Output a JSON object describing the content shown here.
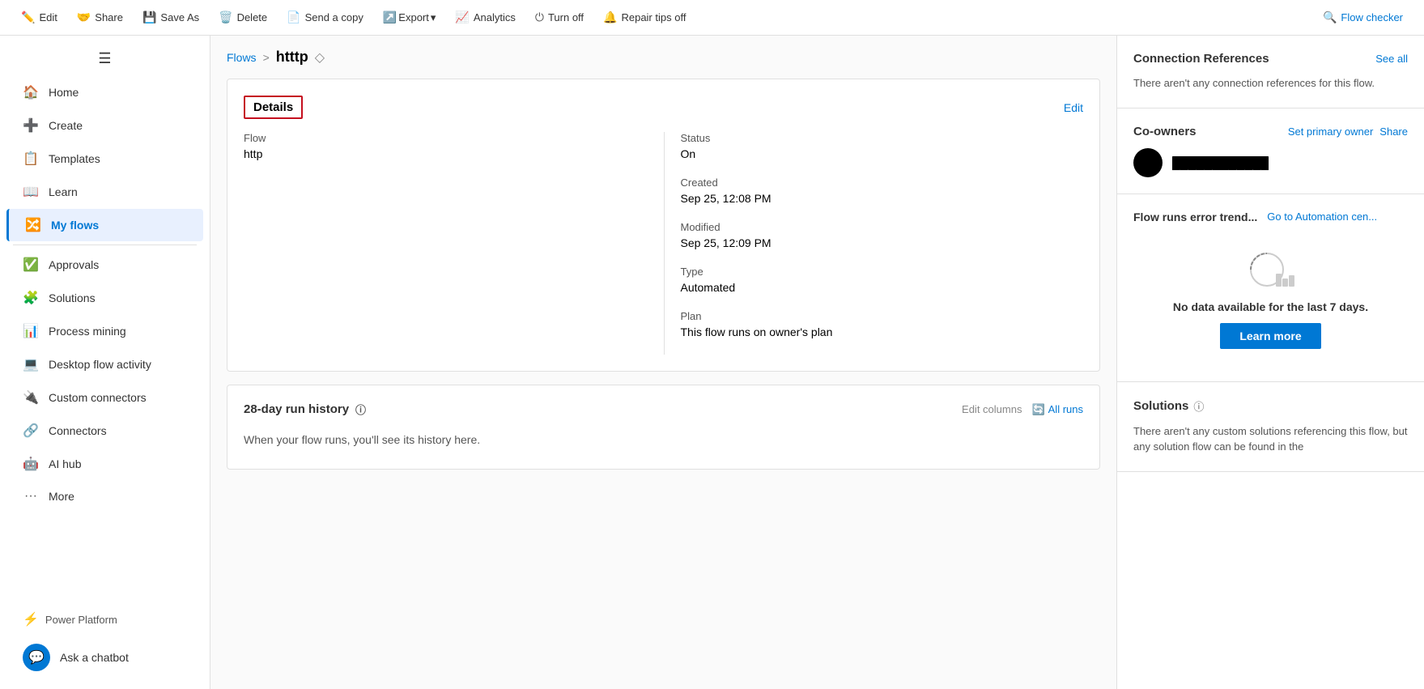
{
  "toolbar": {
    "edit_label": "Edit",
    "share_label": "Share",
    "save_as_label": "Save As",
    "delete_label": "Delete",
    "send_copy_label": "Send a copy",
    "export_label": "Export",
    "analytics_label": "Analytics",
    "turn_off_label": "Turn off",
    "repair_tips_label": "Repair tips off",
    "flow_checker_label": "Flow checker"
  },
  "sidebar": {
    "hamburger_title": "Menu",
    "items": [
      {
        "id": "home",
        "label": "Home",
        "icon": "🏠"
      },
      {
        "id": "create",
        "label": "Create",
        "icon": "➕"
      },
      {
        "id": "templates",
        "label": "Templates",
        "icon": "📋"
      },
      {
        "id": "learn",
        "label": "Learn",
        "icon": "📖"
      },
      {
        "id": "my-flows",
        "label": "My flows",
        "icon": "🔀",
        "active": true
      },
      {
        "id": "approvals",
        "label": "Approvals",
        "icon": "✅"
      },
      {
        "id": "solutions",
        "label": "Solutions",
        "icon": "🧩"
      },
      {
        "id": "process-mining",
        "label": "Process mining",
        "icon": "📊"
      },
      {
        "id": "desktop-flow-activity",
        "label": "Desktop flow activity",
        "icon": "💻"
      },
      {
        "id": "custom-connectors",
        "label": "Custom connectors",
        "icon": "🔌"
      },
      {
        "id": "connectors",
        "label": "Connectors",
        "icon": "🔗"
      },
      {
        "id": "ai-hub",
        "label": "AI hub",
        "icon": "🤖"
      },
      {
        "id": "more",
        "label": "More",
        "icon": "···"
      }
    ],
    "power_platform_label": "Power Platform",
    "ask_chatbot_label": "Ask a chatbot"
  },
  "breadcrumb": {
    "flows_label": "Flows",
    "separator": ">",
    "current_flow": "htttp"
  },
  "details_card": {
    "title": "Details",
    "edit_label": "Edit",
    "flow_label": "Flow",
    "flow_value": "http",
    "status_label": "Status",
    "status_value": "On",
    "created_label": "Created",
    "created_value": "Sep 25, 12:08 PM",
    "modified_label": "Modified",
    "modified_value": "Sep 25, 12:09 PM",
    "type_label": "Type",
    "type_value": "Automated",
    "plan_label": "Plan",
    "plan_value": "This flow runs on owner's plan"
  },
  "run_history_card": {
    "title": "28-day run history",
    "edit_columns_label": "Edit columns",
    "all_runs_label": "All runs",
    "empty_message": "When your flow runs, you'll see its history here."
  },
  "right_panel": {
    "connection_references": {
      "title": "Connection References",
      "see_all_label": "See all",
      "empty_text": "There aren't any connection references for this flow."
    },
    "co_owners": {
      "title": "Co-owners",
      "set_primary_owner_label": "Set primary owner",
      "share_label": "Share",
      "owner_name": "████████████"
    },
    "error_trend": {
      "title": "Flow runs error trend...",
      "link_label": "Go to Automation cen...",
      "no_data_text": "No data available for the last 7 days.",
      "learn_more_label": "Learn more"
    },
    "solutions": {
      "title": "Solutions",
      "empty_text": "There aren't any custom solutions referencing this flow, but any solution flow can be found in the"
    }
  }
}
